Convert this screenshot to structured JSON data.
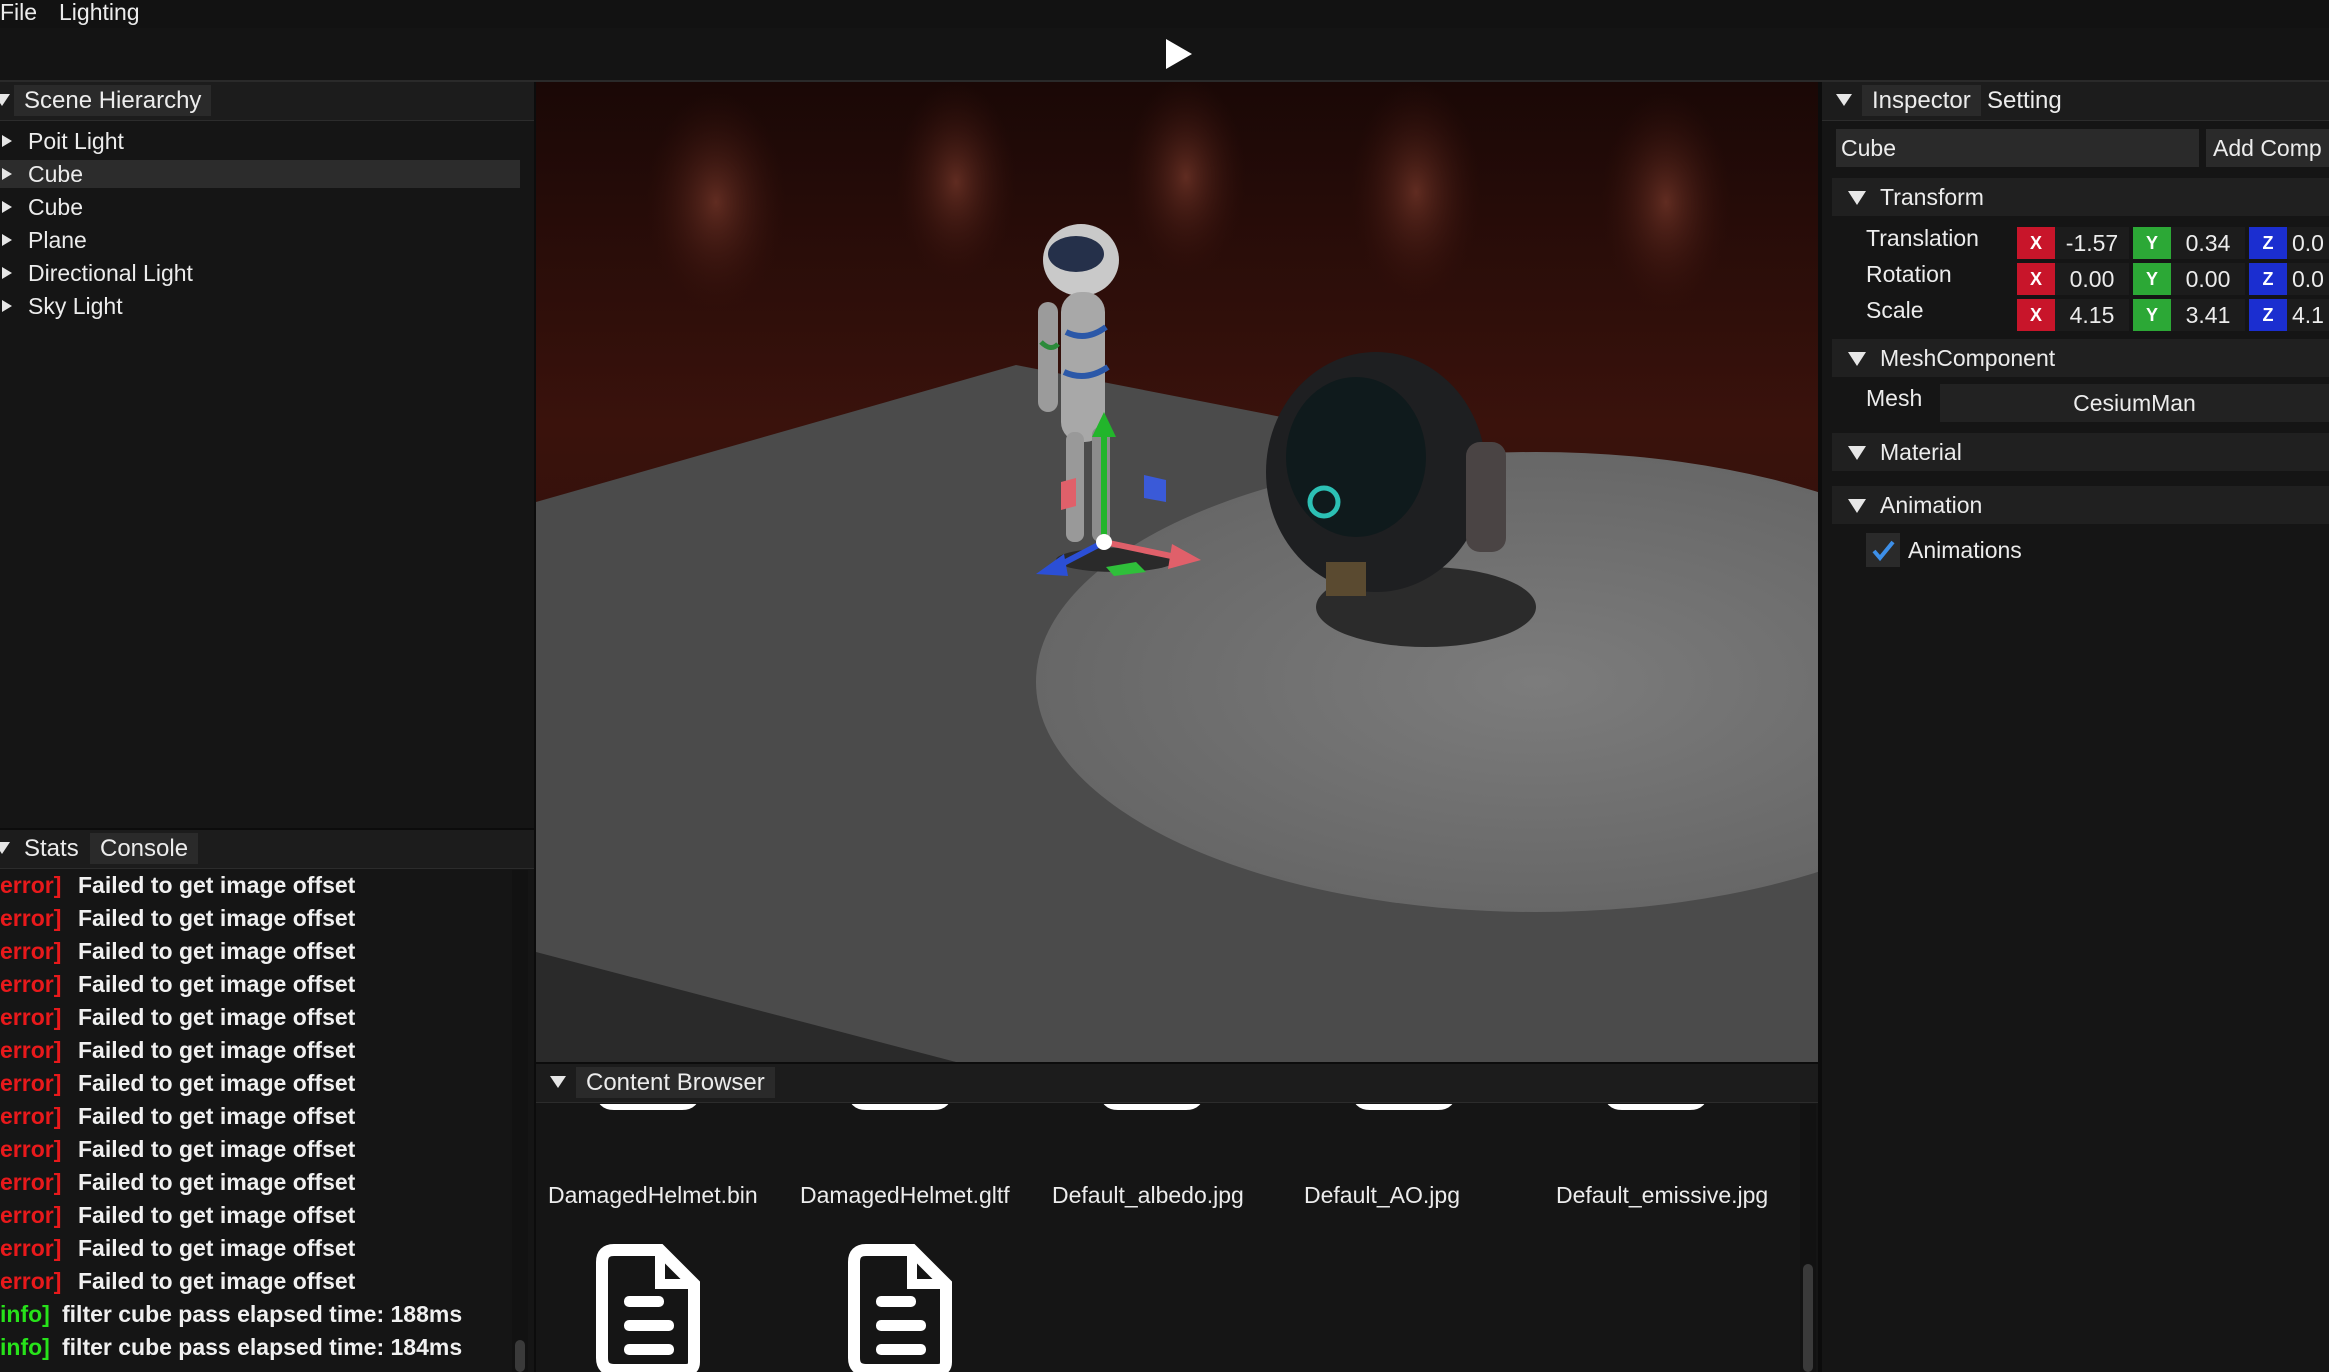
{
  "menu": {
    "file": "File",
    "lighting": "Lighting"
  },
  "toolbar": {
    "play_icon": "play-icon"
  },
  "hierarchy": {
    "tab": "Scene Hierarchy",
    "items": [
      {
        "label": "Poit Light",
        "selected": false
      },
      {
        "label": "Cube",
        "selected": true
      },
      {
        "label": "Cube",
        "selected": false
      },
      {
        "label": "Plane",
        "selected": false
      },
      {
        "label": "Directional Light",
        "selected": false
      },
      {
        "label": "Sky Light",
        "selected": false
      }
    ]
  },
  "bottom_left": {
    "tabs": [
      "Stats",
      "Console"
    ],
    "logs": [
      {
        "tag": "error]",
        "msg": "Failed to get image offset",
        "level": "error"
      },
      {
        "tag": "error]",
        "msg": "Failed to get image offset",
        "level": "error"
      },
      {
        "tag": "error]",
        "msg": "Failed to get image offset",
        "level": "error"
      },
      {
        "tag": "error]",
        "msg": "Failed to get image offset",
        "level": "error"
      },
      {
        "tag": "error]",
        "msg": "Failed to get image offset",
        "level": "error"
      },
      {
        "tag": "error]",
        "msg": "Failed to get image offset",
        "level": "error"
      },
      {
        "tag": "error]",
        "msg": "Failed to get image offset",
        "level": "error"
      },
      {
        "tag": "error]",
        "msg": "Failed to get image offset",
        "level": "error"
      },
      {
        "tag": "error]",
        "msg": "Failed to get image offset",
        "level": "error"
      },
      {
        "tag": "error]",
        "msg": "Failed to get image offset",
        "level": "error"
      },
      {
        "tag": "error]",
        "msg": "Failed to get image offset",
        "level": "error"
      },
      {
        "tag": "error]",
        "msg": "Failed to get image offset",
        "level": "error"
      },
      {
        "tag": "error]",
        "msg": "Failed to get image offset",
        "level": "error"
      },
      {
        "tag": "info]",
        "msg": "filter cube pass elapsed time: 188ms",
        "level": "info"
      },
      {
        "tag": "info]",
        "msg": "filter cube pass elapsed time: 184ms",
        "level": "info"
      }
    ]
  },
  "content_browser": {
    "tab": "Content Browser",
    "files": [
      "DamagedHelmet.bin",
      "DamagedHelmet.gltf",
      "Default_albedo.jpg",
      "Default_AO.jpg",
      "Default_emissive.jpg",
      "",
      ""
    ]
  },
  "inspector": {
    "tabs": [
      "Inspector",
      "Setting"
    ],
    "entity_name": "Cube",
    "add_component": "Add Comp",
    "transform": {
      "title": "Transform",
      "rows": [
        {
          "label": "Translation",
          "x": "-1.57",
          "y": "0.34",
          "z": "0.0"
        },
        {
          "label": "Rotation",
          "x": "0.00",
          "y": "0.00",
          "z": "0.0"
        },
        {
          "label": "Scale",
          "x": "4.15",
          "y": "3.41",
          "z": "4.1"
        }
      ],
      "axis_labels": {
        "x": "X",
        "y": "Y",
        "z": "Z"
      }
    },
    "mesh": {
      "title": "MeshComponent",
      "label": "Mesh",
      "value": "CesiumMan"
    },
    "material": {
      "title": "Material"
    },
    "animation": {
      "title": "Animation",
      "checkbox_label": "Animations",
      "checked": true
    }
  },
  "colors": {
    "error": "#e8191b",
    "info": "#27e21a",
    "axis_x": "#c8152a",
    "axis_y": "#2ca836",
    "axis_z": "#1b2ed0",
    "checkbox": "#3d8fe8"
  }
}
